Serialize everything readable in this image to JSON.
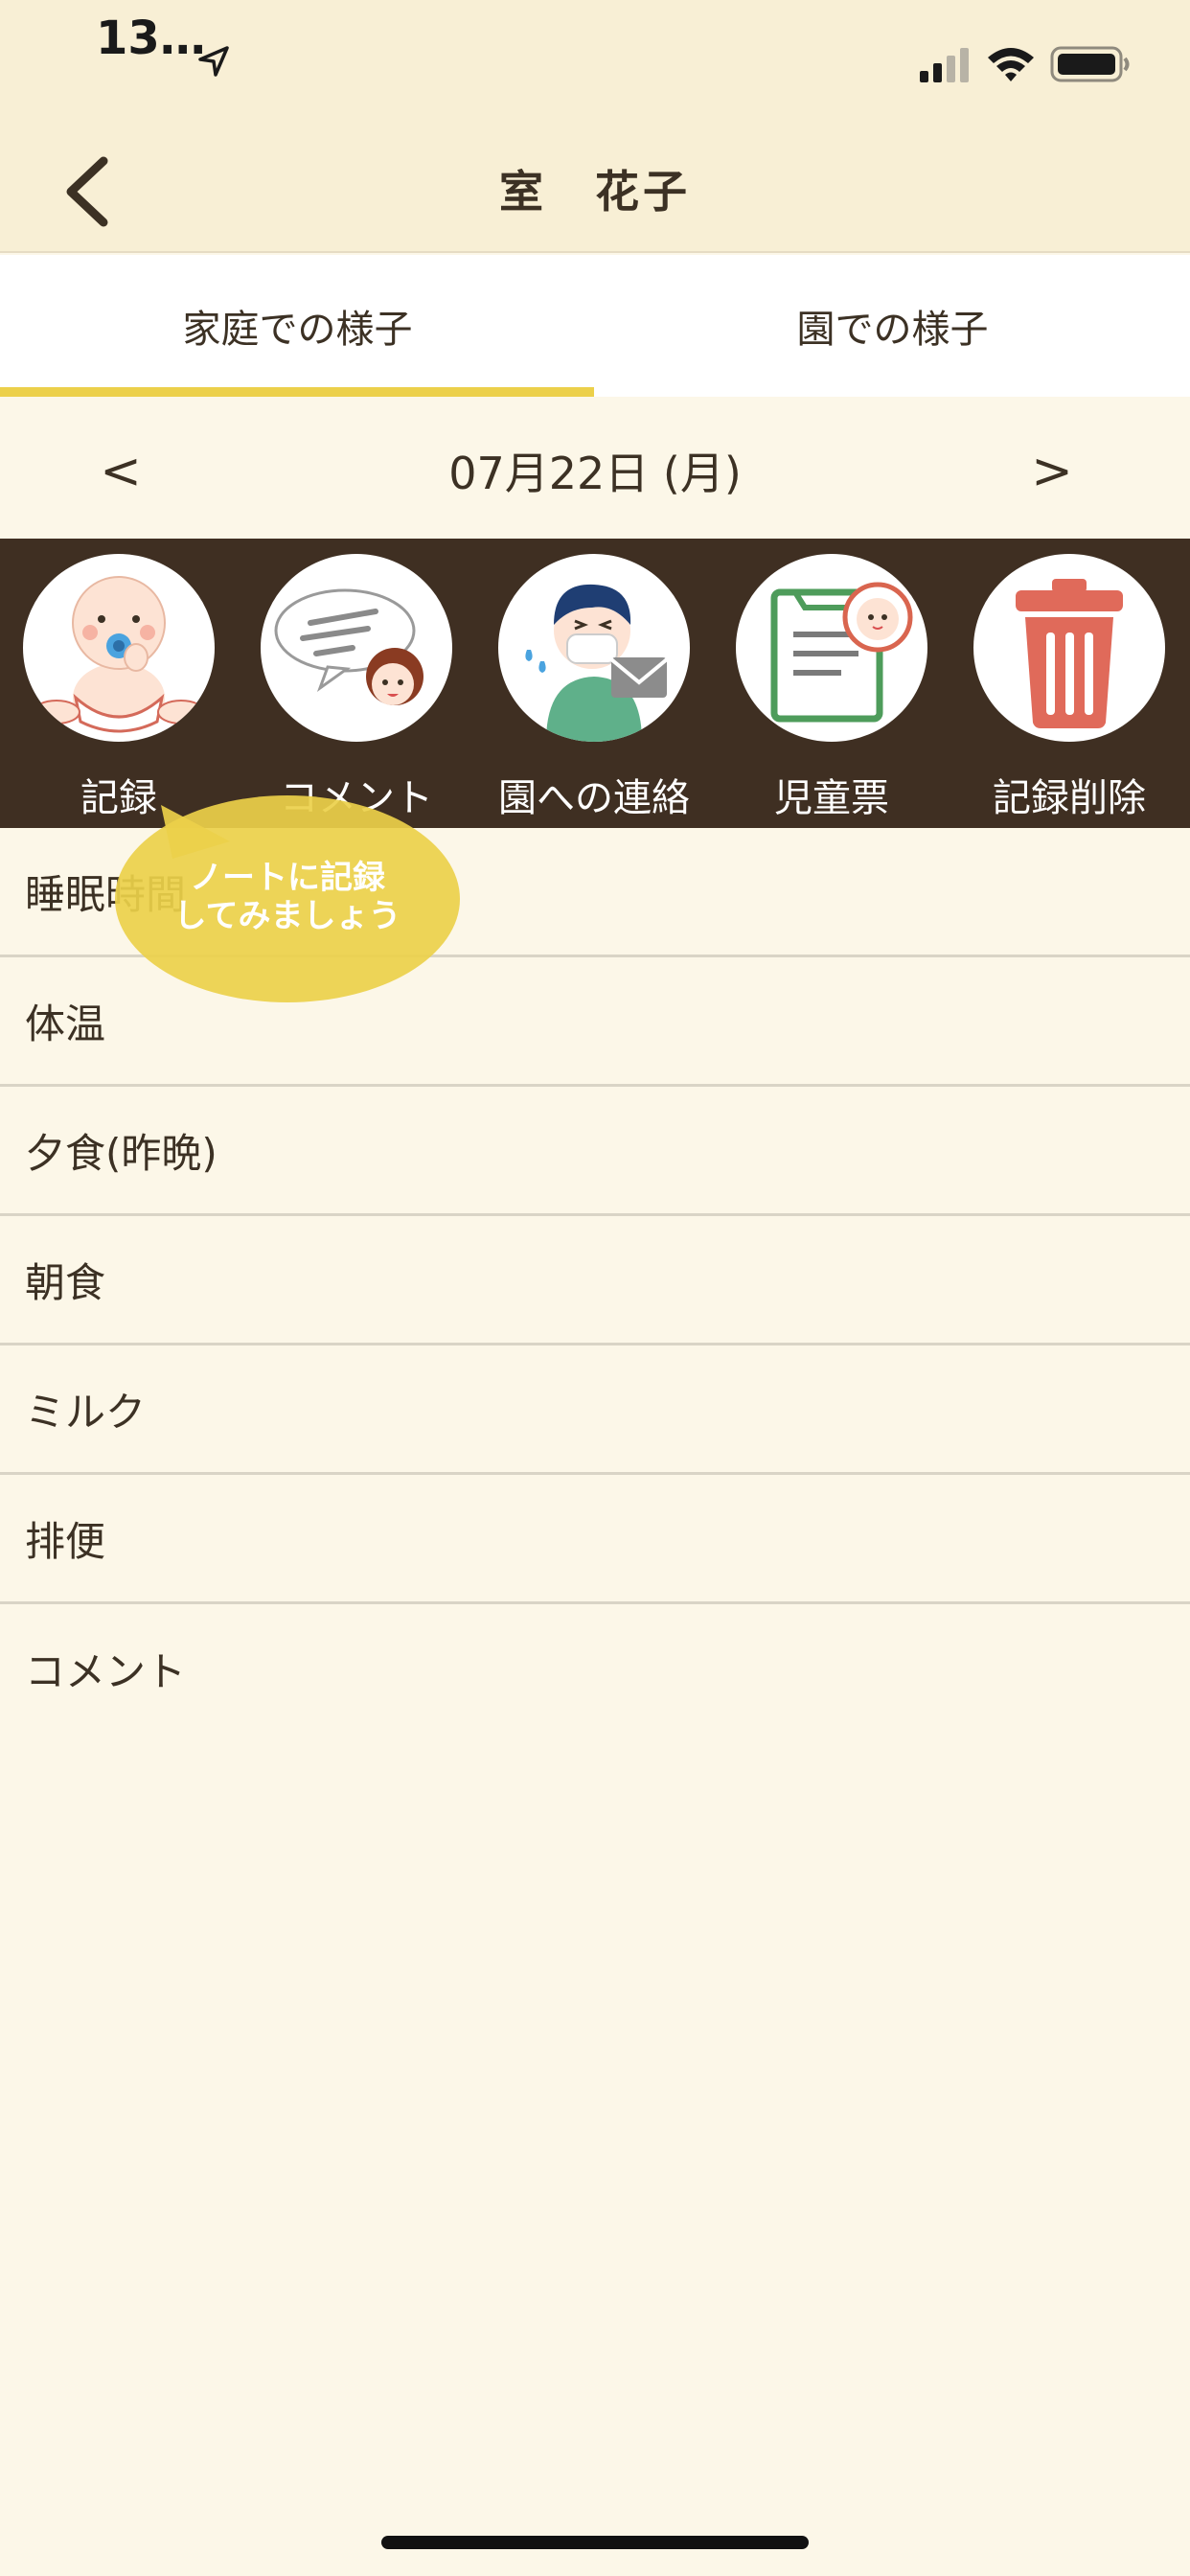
{
  "status_bar": {
    "time": "13…",
    "icons": [
      "location-arrow-icon",
      "cellular-signal-icon",
      "wifi-icon",
      "battery-icon"
    ]
  },
  "header": {
    "title": "室　花子",
    "back_icon": "chevron-left-icon"
  },
  "tabs": [
    {
      "label": "家庭での様子",
      "selected": true
    },
    {
      "label": "園での様子",
      "selected": false
    }
  ],
  "date_nav": {
    "prev": "<",
    "date": "07月22日 (月)",
    "next": ">"
  },
  "actions": [
    {
      "label": "記録",
      "icon": "baby-icon"
    },
    {
      "label": "コメント",
      "icon": "speech-bubble-icon"
    },
    {
      "label": "園への連絡",
      "icon": "sick-child-mail-icon"
    },
    {
      "label": "児童票",
      "icon": "child-record-clipboard-icon"
    },
    {
      "label": "記録削除",
      "icon": "trash-icon"
    }
  ],
  "tooltip": {
    "line1": "ノートに記録",
    "line2": "してみましょう"
  },
  "list_items": [
    "睡眠時間",
    "体温",
    "夕食(昨晩)",
    "朝食",
    "ミルク",
    "排便",
    "コメント"
  ],
  "colors": {
    "header_bg": "#f8efd5",
    "page_bg": "#fcf7e8",
    "toolbar_bg": "#3f2f22",
    "accent_yellow": "#ecd04a",
    "text": "#3c3124"
  }
}
